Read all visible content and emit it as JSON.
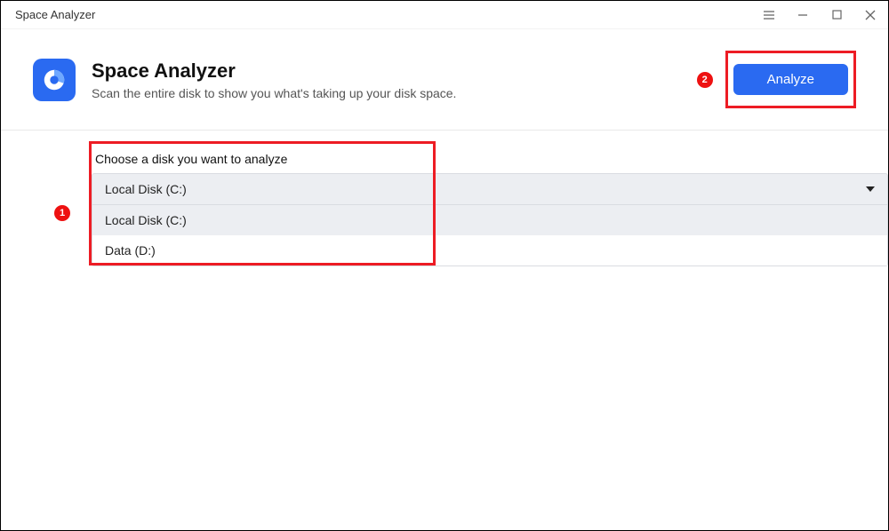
{
  "titlebar": {
    "title": "Space Analyzer"
  },
  "header": {
    "title": "Space Analyzer",
    "subtitle": "Scan the entire disk to show you what's taking up your disk space.",
    "analyze_label": "Analyze"
  },
  "content": {
    "choose_label": "Choose a disk you want to analyze",
    "selected": "Local Disk (C:)",
    "options": [
      "Local Disk (C:)",
      "Data (D:)"
    ]
  },
  "callouts": {
    "one": "1",
    "two": "2"
  }
}
